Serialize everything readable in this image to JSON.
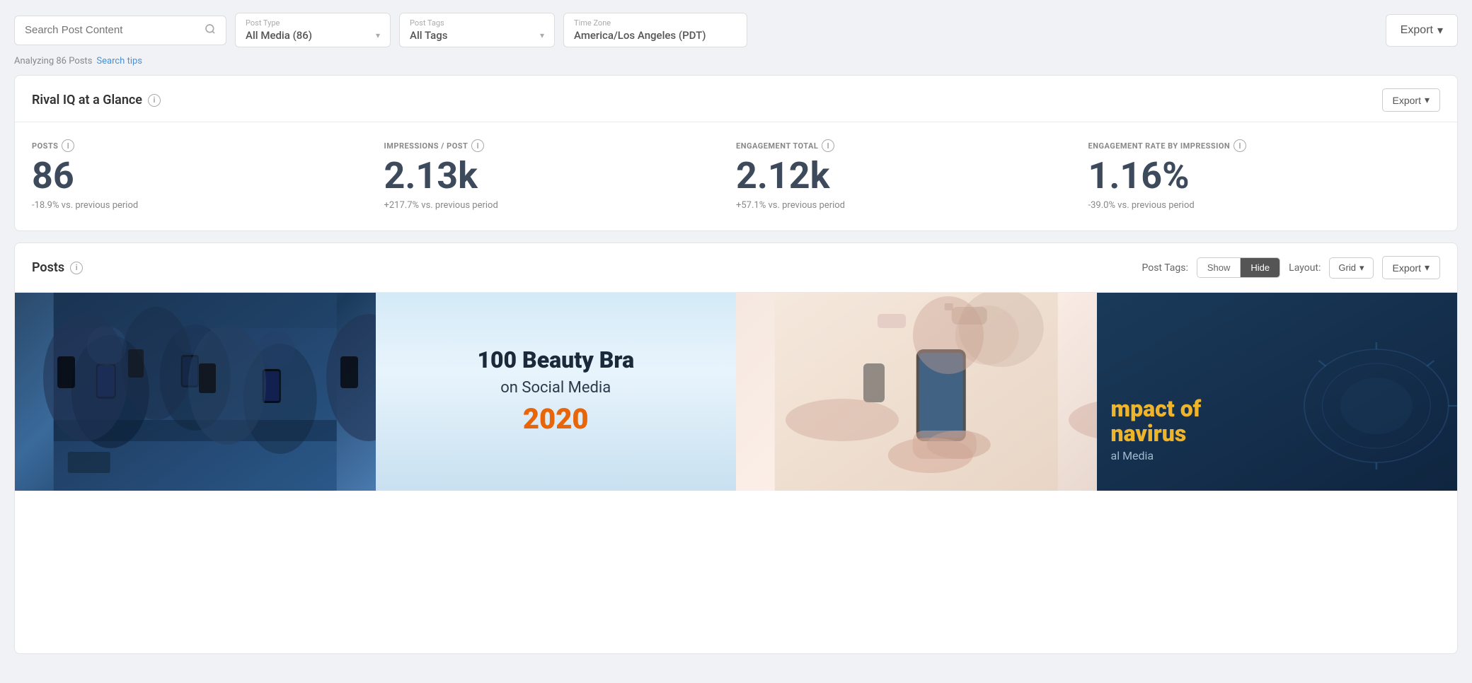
{
  "toolbar": {
    "search_placeholder": "Search Post Content",
    "post_type_label": "Post Type",
    "post_type_value": "All Media (86)",
    "post_tags_label": "Post Tags",
    "post_tags_value": "All Tags",
    "timezone_label": "Time Zone",
    "timezone_value": "America/Los Angeles (PDT)",
    "export_label": "Export"
  },
  "subtoolbar": {
    "analyzing_text": "Analyzing 86 Posts",
    "search_tips_label": "Search tips"
  },
  "glance": {
    "title": "Rival IQ at a Glance",
    "export_label": "Export",
    "stats": [
      {
        "label": "POSTS",
        "value": "86",
        "compare": "-18.9% vs. previous period"
      },
      {
        "label": "IMPRESSIONS / POST",
        "value": "2.13k",
        "compare": "+217.7% vs. previous period"
      },
      {
        "label": "ENGAGEMENT TOTAL",
        "value": "2.12k",
        "compare": "+57.1% vs. previous period"
      },
      {
        "label": "ENGAGEMENT RATE BY IMPRESSION",
        "value": "1.16%",
        "compare": "-39.0% vs. previous period"
      }
    ]
  },
  "posts": {
    "title": "Posts",
    "post_tags_label": "Post Tags:",
    "show_label": "Show",
    "hide_label": "Hide",
    "layout_label": "Layout:",
    "grid_label": "Grid",
    "export_label": "Export",
    "items": [
      {
        "type": "photo",
        "alt": "People with phones dark blue"
      },
      {
        "type": "beauty",
        "line1": "100 Beauty Bra",
        "line2": "on Social Media",
        "year": "2020"
      },
      {
        "type": "phone",
        "alt": "Person holding phone"
      },
      {
        "type": "covid",
        "main": "mpact of",
        "sub": "navirus",
        "extra": "al Media"
      }
    ]
  },
  "icons": {
    "search": "🔍",
    "chevron_down": "▾",
    "info": "i",
    "export_arrow": "▾"
  }
}
